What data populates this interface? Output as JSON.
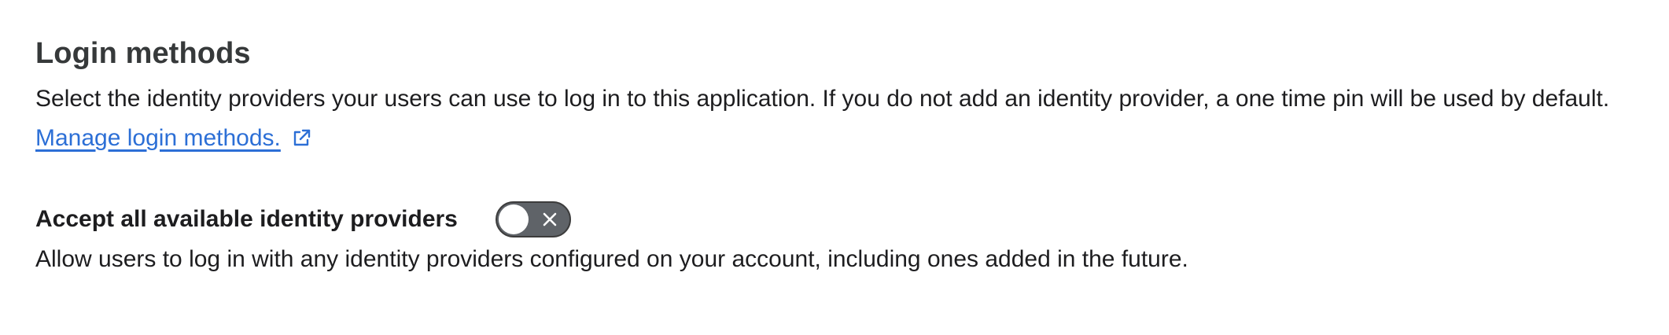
{
  "login_methods": {
    "title": "Login methods",
    "description": "Select the identity providers your users can use to log in to this application. If you do not add an identity provider, a one time pin will be used by default.",
    "manage_link": "Manage login methods.",
    "manage_link_icon": "external-link-icon"
  },
  "accept_all": {
    "label": "Accept all available identity providers",
    "enabled": false,
    "toggle_off_icon": "close-icon",
    "help": "Allow users to log in with any identity providers configured on your account, including ones added in the future."
  },
  "colors": {
    "link": "#2c6fd6",
    "toggle_off_bg": "#5f6368",
    "heading": "#36393a"
  }
}
